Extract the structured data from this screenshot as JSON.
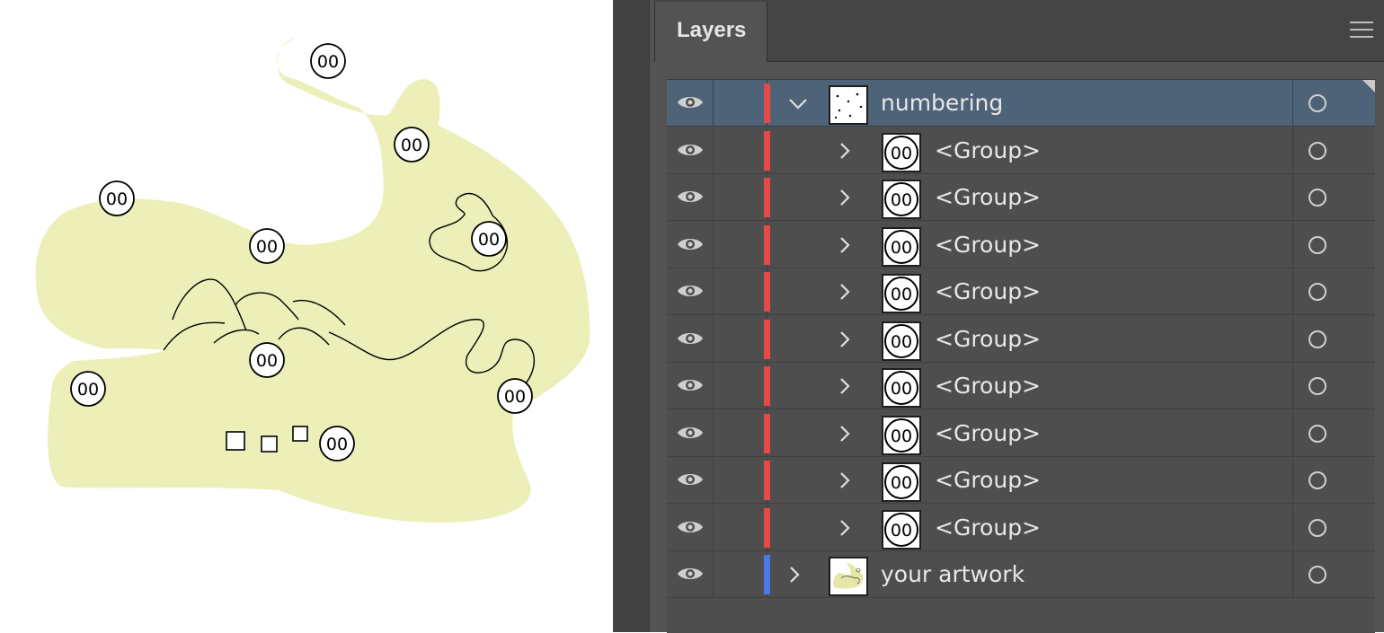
{
  "panel": {
    "tab_label": "Layers",
    "menu_icon": "hamburger-menu-icon"
  },
  "colors": {
    "numbering_layer": "#e64a46",
    "artwork_layer": "#4a7ae8",
    "selected_row": "#4e6278",
    "blob_fill": "#ecefb8"
  },
  "canvas": {
    "badge_label": "00"
  },
  "layers": [
    {
      "label": "numbering",
      "level": 0,
      "expanded": true,
      "selected": true,
      "color": "#e64a46",
      "thumb": "dots"
    },
    {
      "label": "<Group>",
      "level": 1,
      "expanded": false,
      "selected": false,
      "color": "#e64a46",
      "thumb": "badge"
    },
    {
      "label": "<Group>",
      "level": 1,
      "expanded": false,
      "selected": false,
      "color": "#e64a46",
      "thumb": "badge"
    },
    {
      "label": "<Group>",
      "level": 1,
      "expanded": false,
      "selected": false,
      "color": "#e64a46",
      "thumb": "badge"
    },
    {
      "label": "<Group>",
      "level": 1,
      "expanded": false,
      "selected": false,
      "color": "#e64a46",
      "thumb": "badge"
    },
    {
      "label": "<Group>",
      "level": 1,
      "expanded": false,
      "selected": false,
      "color": "#e64a46",
      "thumb": "badge"
    },
    {
      "label": "<Group>",
      "level": 1,
      "expanded": false,
      "selected": false,
      "color": "#e64a46",
      "thumb": "badge"
    },
    {
      "label": "<Group>",
      "level": 1,
      "expanded": false,
      "selected": false,
      "color": "#e64a46",
      "thumb": "badge"
    },
    {
      "label": "<Group>",
      "level": 1,
      "expanded": false,
      "selected": false,
      "color": "#e64a46",
      "thumb": "badge"
    },
    {
      "label": "<Group>",
      "level": 1,
      "expanded": false,
      "selected": false,
      "color": "#e64a46",
      "thumb": "badge"
    },
    {
      "label": "your artwork",
      "level": 0,
      "expanded": false,
      "selected": false,
      "color": "#4a7ae8",
      "thumb": "art"
    }
  ]
}
